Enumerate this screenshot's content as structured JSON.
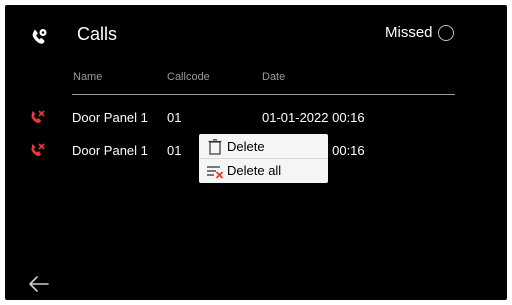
{
  "header": {
    "title": "Calls",
    "app_icon": "phone-settings-icon",
    "missed_filter": {
      "label": "Missed",
      "checked": false
    }
  },
  "table": {
    "columns": [
      "Name",
      "Callcode",
      "Date"
    ],
    "rows": [
      {
        "name": "Door Panel 1",
        "callcode": "01",
        "date": "01-01-2022 00:16",
        "status": "missed",
        "icon": "missed-call-icon"
      },
      {
        "name": "Door Panel 1",
        "callcode": "01",
        "date": "01-01-2022 00:16",
        "status": "missed",
        "icon": "missed-call-icon"
      }
    ]
  },
  "context_menu": {
    "items": [
      {
        "label": "Delete",
        "icon": "trash-icon"
      },
      {
        "label": "Delete all",
        "icon": "delete-all-icon"
      }
    ]
  },
  "footer": {
    "back_icon": "back-arrow-icon"
  },
  "colors": {
    "background": "#000000",
    "text": "#ffffff",
    "muted": "#9a9a9a",
    "missed": "#e53935",
    "menu_bg": "#f5f5f5"
  }
}
